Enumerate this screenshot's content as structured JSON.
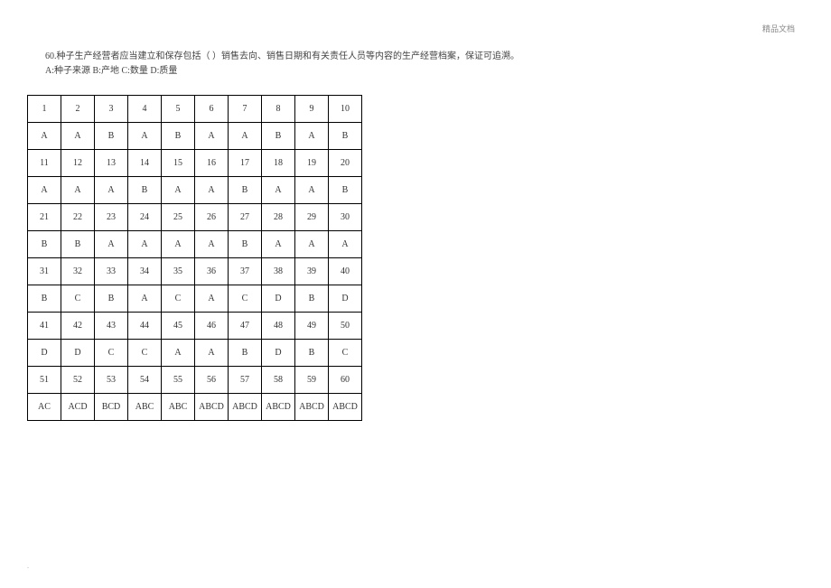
{
  "watermark": "精品文档",
  "question": {
    "number": "60.",
    "text": "种子生产经营者应当建立和保存包括（   ）销售去向、销售日期和有关责任人员等内容的生产经营档案，保证可追溯。",
    "options": "A:种子来源   B:产地   C:数量   D:质量"
  },
  "chart_data": {
    "type": "table",
    "title": "",
    "rows": [
      [
        "1",
        "2",
        "3",
        "4",
        "5",
        "6",
        "7",
        "8",
        "9",
        "10"
      ],
      [
        "A",
        "A",
        "B",
        "A",
        "B",
        "A",
        "A",
        "B",
        "A",
        "B"
      ],
      [
        "11",
        "12",
        "13",
        "14",
        "15",
        "16",
        "17",
        "18",
        "19",
        "20"
      ],
      [
        "A",
        "A",
        "A",
        "B",
        "A",
        "A",
        "B",
        "A",
        "A",
        "B"
      ],
      [
        "21",
        "22",
        "23",
        "24",
        "25",
        "26",
        "27",
        "28",
        "29",
        "30"
      ],
      [
        "B",
        "B",
        "A",
        "A",
        "A",
        "A",
        "B",
        "A",
        "A",
        "A"
      ],
      [
        "31",
        "32",
        "33",
        "34",
        "35",
        "36",
        "37",
        "38",
        "39",
        "40"
      ],
      [
        "B",
        "C",
        "B",
        "A",
        "C",
        "A",
        "C",
        "D",
        "B",
        "D"
      ],
      [
        "41",
        "42",
        "43",
        "44",
        "45",
        "46",
        "47",
        "48",
        "49",
        "50"
      ],
      [
        "D",
        "D",
        "C",
        "C",
        "A",
        "A",
        "B",
        "D",
        "B",
        "C"
      ],
      [
        "51",
        "52",
        "53",
        "54",
        "55",
        "56",
        "57",
        "58",
        "59",
        "60"
      ],
      [
        "AC",
        "ACD",
        "BCD",
        "ABC",
        "ABC",
        "ABCD",
        "ABCD",
        "ABCD",
        "ABCD",
        "ABCD"
      ]
    ]
  },
  "footer": "."
}
